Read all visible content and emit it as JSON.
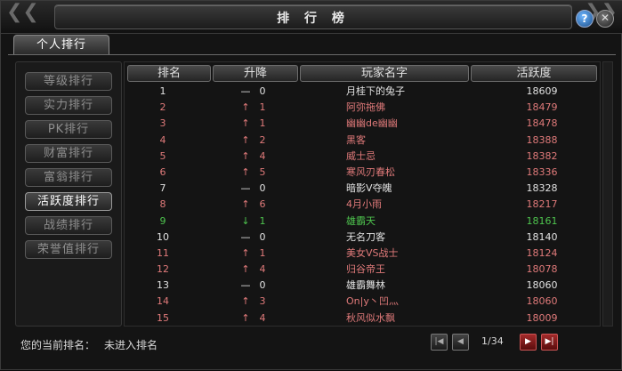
{
  "window": {
    "title": "排 行 榜"
  },
  "tab": {
    "label": "个人排行"
  },
  "categories": [
    "等级排行",
    "实力排行",
    "PK排行",
    "财富排行",
    "富翁排行",
    "活跃度排行",
    "战绩排行",
    "荣誉值排行"
  ],
  "active_category_index": 5,
  "columns": {
    "rank": "排名",
    "change": "升降",
    "name": "玩家名字",
    "activity": "活跃度"
  },
  "rows": [
    {
      "rank": "1",
      "arrow": "—",
      "change": "0",
      "name": "月桂下的兔子",
      "activity": "18609",
      "trend": "plain"
    },
    {
      "rank": "2",
      "arrow": "↑",
      "change": "1",
      "name": "阿弥拖佛",
      "activity": "18479",
      "trend": "up"
    },
    {
      "rank": "3",
      "arrow": "↑",
      "change": "1",
      "name": "幽幽de幽幽",
      "activity": "18478",
      "trend": "up"
    },
    {
      "rank": "4",
      "arrow": "↑",
      "change": "2",
      "name": "黑客",
      "activity": "18388",
      "trend": "up"
    },
    {
      "rank": "5",
      "arrow": "↑",
      "change": "4",
      "name": "威士忌",
      "activity": "18382",
      "trend": "up"
    },
    {
      "rank": "6",
      "arrow": "↑",
      "change": "5",
      "name": "寒风刃春松",
      "activity": "18336",
      "trend": "up"
    },
    {
      "rank": "7",
      "arrow": "—",
      "change": "0",
      "name": "暗影V夺魄",
      "activity": "18328",
      "trend": "plain"
    },
    {
      "rank": "8",
      "arrow": "↑",
      "change": "6",
      "name": "4月小雨",
      "activity": "18217",
      "trend": "up"
    },
    {
      "rank": "9",
      "arrow": "↓",
      "change": "1",
      "name": "雄霸天",
      "activity": "18161",
      "trend": "down"
    },
    {
      "rank": "10",
      "arrow": "—",
      "change": "0",
      "name": "无名刀客",
      "activity": "18140",
      "trend": "plain"
    },
    {
      "rank": "11",
      "arrow": "↑",
      "change": "1",
      "name": "美女VS战士",
      "activity": "18124",
      "trend": "up"
    },
    {
      "rank": "12",
      "arrow": "↑",
      "change": "4",
      "name": "归谷帝王",
      "activity": "18078",
      "trend": "up"
    },
    {
      "rank": "13",
      "arrow": "—",
      "change": "0",
      "name": "雄霸舞林",
      "activity": "18060",
      "trend": "plain"
    },
    {
      "rank": "14",
      "arrow": "↑",
      "change": "3",
      "name": "On|y丶凹灬",
      "activity": "18060",
      "trend": "up"
    },
    {
      "rank": "15",
      "arrow": "↑",
      "change": "4",
      "name": "秋风似水飘",
      "activity": "18009",
      "trend": "up"
    }
  ],
  "footer": {
    "current_rank_label": "您的当前排名：",
    "current_rank_value": "未进入排名",
    "page": "1/34"
  },
  "colors": {
    "up": "#e07a7a",
    "down": "#4ec44e",
    "plain": "#e2e2e2"
  }
}
